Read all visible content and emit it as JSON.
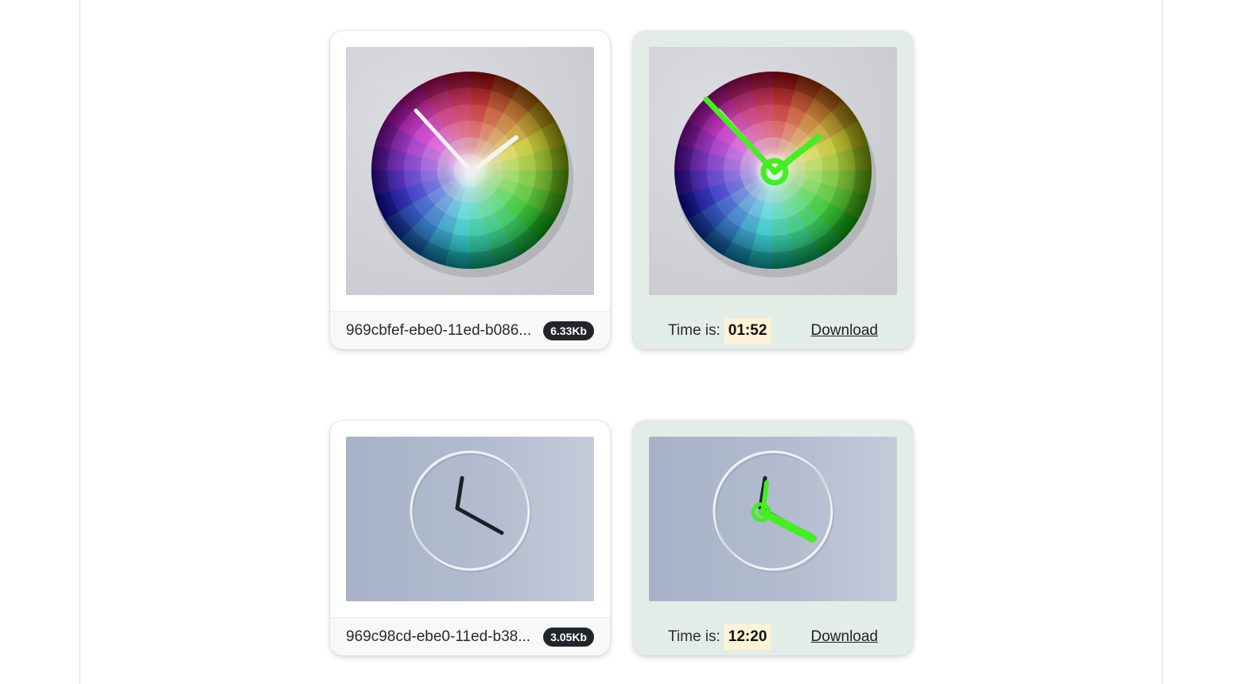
{
  "cards": [
    {
      "input": {
        "filename": "969cbfef-ebe0-11ed-b086...",
        "size": "6.33Kb"
      },
      "result": {
        "time_label": "Time is:",
        "time_value": "01:52",
        "download_label": "Download"
      }
    },
    {
      "input": {
        "filename": "969c98cd-ebe0-11ed-b38...",
        "size": "3.05Kb"
      },
      "result": {
        "time_label": "Time is:",
        "time_value": "12:20",
        "download_label": "Download"
      }
    }
  ],
  "colors": {
    "result_card_bg": "#e3ede7",
    "badge_bg": "#22262a",
    "time_highlight": "#fcf3d6",
    "detection_green": "#44ee22"
  },
  "icons": [
    "color-wheel-clock-image",
    "minimal-clock-image",
    "detected-hands-overlay"
  ]
}
